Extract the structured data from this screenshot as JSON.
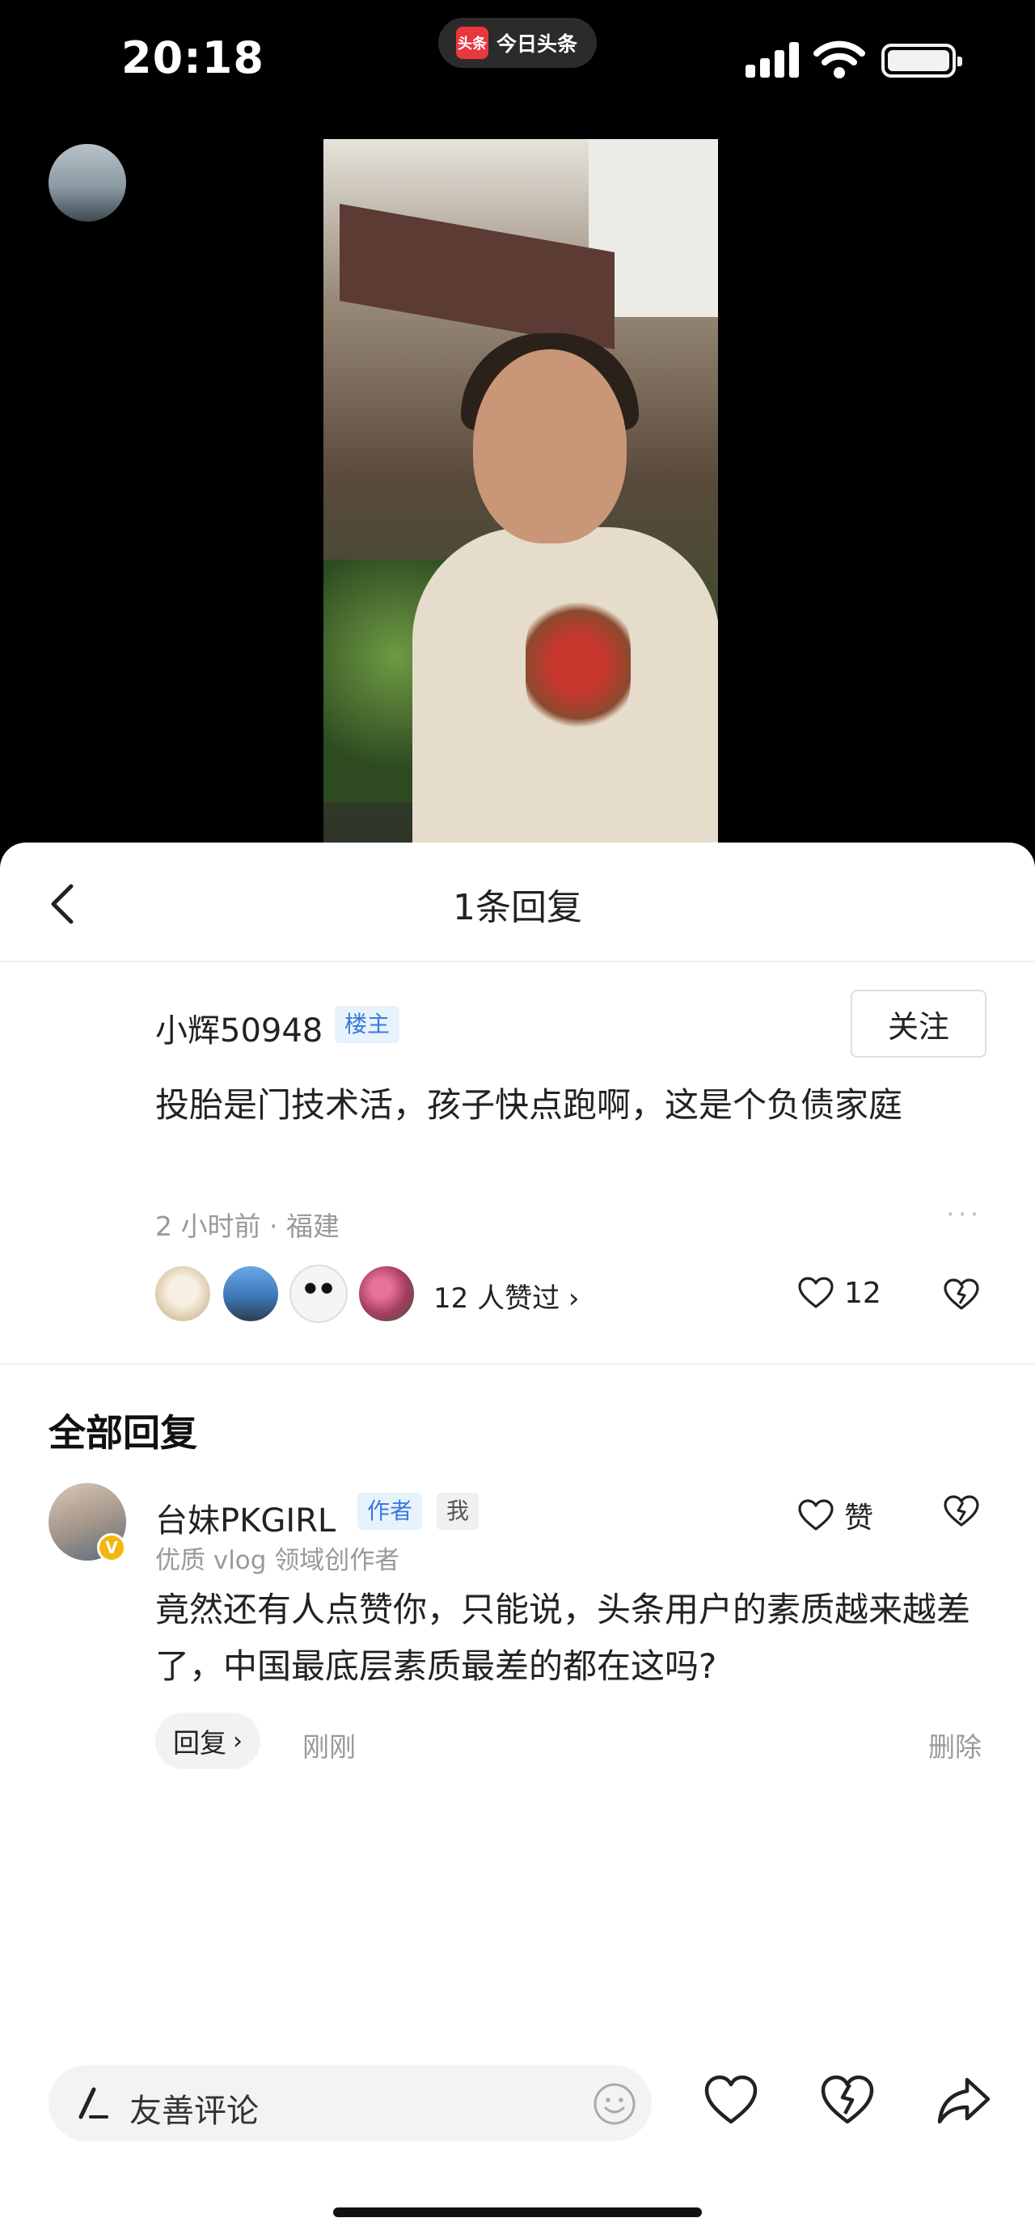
{
  "status_bar": {
    "time": "20:18",
    "app_logo": "头条",
    "app_name": "今日头条"
  },
  "header": {
    "title": "1条回复"
  },
  "main_comment": {
    "username": "小辉50948",
    "tag": "楼主",
    "follow_label": "关注",
    "text": "投胎是门技术活，孩子快点跑啊，这是个负债家庭",
    "meta": "2 小时前 · 福建",
    "likers_text": "12 人赞过 ›",
    "like_count": "12"
  },
  "replies_section": {
    "title": "全部回复"
  },
  "reply": {
    "username": "台妹PKGIRL",
    "author_tag": "作者",
    "me_tag": "我",
    "subtitle": "优质 vlog 领域创作者",
    "verified_badge": "V",
    "like_label": "赞",
    "text": "竟然还有人点赞你，只能说，头条用户的素质越来越差了，中国最底层素质最差的都在这吗?",
    "reply_button_label": "回复",
    "time": "刚刚",
    "delete_label": "删除"
  },
  "composer": {
    "placeholder": "友善评论"
  },
  "colors": {
    "accent_blue": "#3a7ad8",
    "brand_red": "#e8383d",
    "muted": "#999999"
  }
}
